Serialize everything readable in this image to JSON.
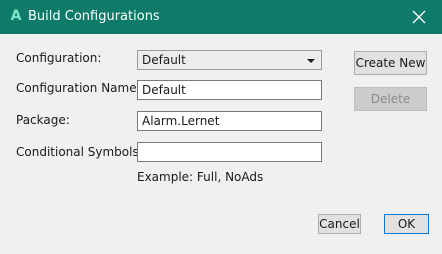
{
  "window": {
    "title": "Build Configurations",
    "app_icon": "A"
  },
  "form": {
    "configuration_label": "Configuration:",
    "configuration_value": "Default",
    "configuration_name_label": "Configuration Name:",
    "configuration_name_value": "Default",
    "package_label": "Package:",
    "package_value": "Alarm.Lernet",
    "conditional_symbols_label": "Conditional Symbols:",
    "conditional_symbols_value": "",
    "hint": "Example: Full, NoAds"
  },
  "buttons": {
    "create_new": "Create New",
    "delete": "Delete",
    "cancel": "Cancel",
    "ok": "OK"
  },
  "colors": {
    "titlebar": "#0e7a6a",
    "app_icon": "#7fe3c9",
    "primary_border": "#0078d7"
  },
  "icons": {
    "close": "close-icon",
    "dropdown": "chevron-down-icon"
  }
}
